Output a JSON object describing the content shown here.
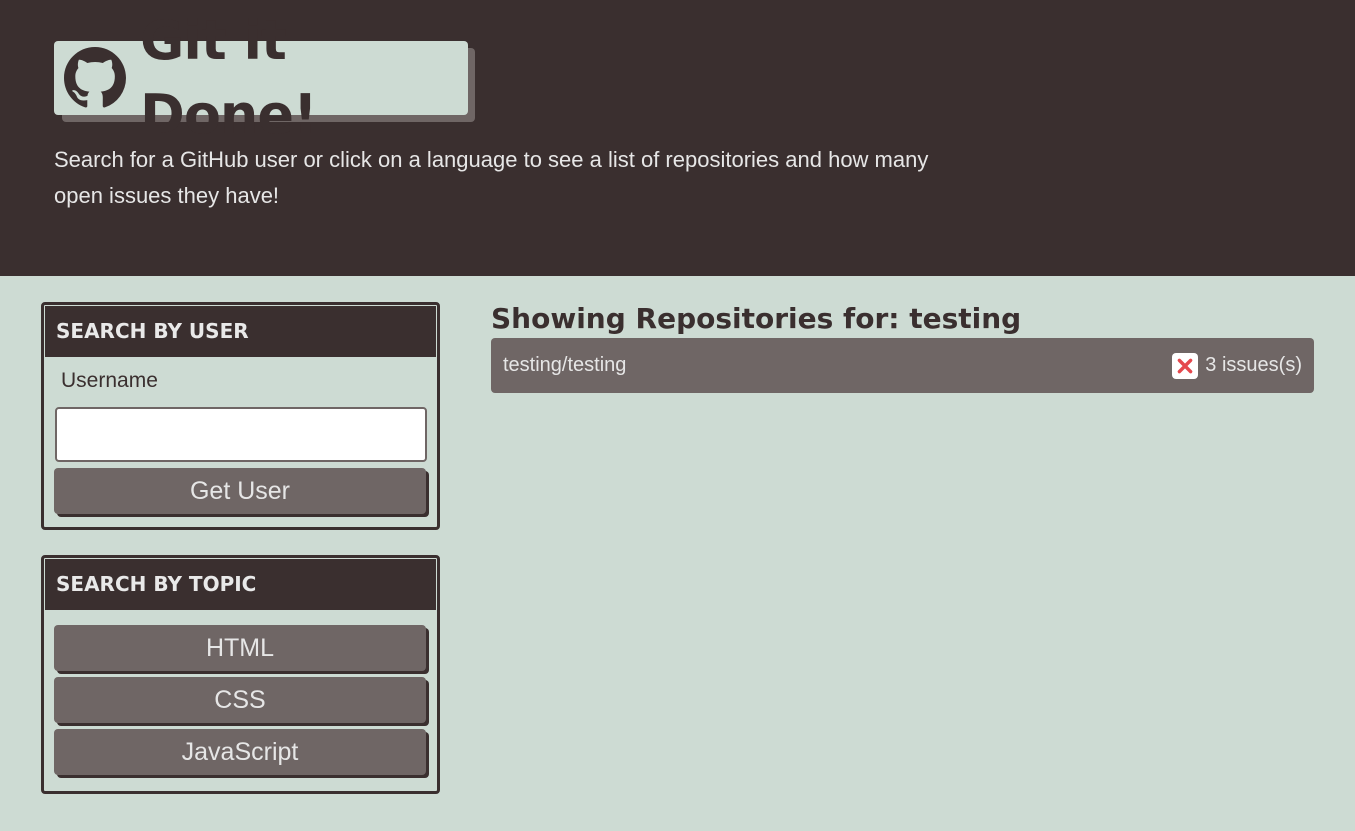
{
  "header": {
    "title": "Git it Done!",
    "logo_icon": "github-icon",
    "subtitle": "Search for a GitHub user or click on a language to see a list of repositories and how many open issues they have!"
  },
  "user_search": {
    "heading": "SEARCH BY USER",
    "username_label": "Username",
    "username_value": "",
    "username_placeholder": "",
    "button_label": "Get User"
  },
  "topic_search": {
    "heading": "SEARCH BY TOPIC",
    "topics": [
      "HTML",
      "CSS",
      "JavaScript"
    ]
  },
  "results": {
    "title": "Showing Repositories for: testing",
    "repos": [
      {
        "name": "testing/testing",
        "status_icon": "x-icon",
        "issues": "3 issues(s)"
      }
    ]
  },
  "colors": {
    "dark": "#3a2f2f",
    "light": "#cddbd3",
    "mid": "#6f6665",
    "danger": "#e5484d"
  }
}
